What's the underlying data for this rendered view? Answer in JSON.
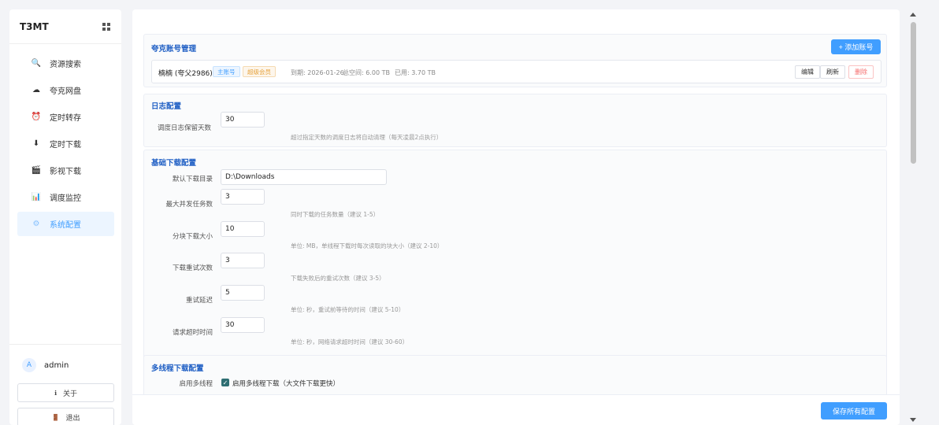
{
  "sidebar": {
    "brand": "T3MT",
    "items": [
      {
        "label": "资源搜索",
        "icon": "🔍"
      },
      {
        "label": "夸克网盘",
        "icon": "☁"
      },
      {
        "label": "定时转存",
        "icon": "⏰"
      },
      {
        "label": "定时下载",
        "icon": "⬇"
      },
      {
        "label": "影视下载",
        "icon": "🎬"
      },
      {
        "label": "调度监控",
        "icon": "📊"
      },
      {
        "label": "系统配置",
        "icon": "⚙"
      }
    ],
    "active_index": 6,
    "user": {
      "avatar": "A",
      "name": "admin"
    },
    "about_label": "关于",
    "about_icon": "ℹ",
    "logout_label": "退出",
    "logout_icon": "🚪"
  },
  "quark": {
    "title": "夸克账号管理",
    "add_button": "+ 添加账号",
    "account": {
      "name": "楠楠 (夸父2986)",
      "tag_main": "主账号",
      "tag_vip": "超级会员",
      "expire": "到期: 2026-01-26",
      "total": "总空间: 6.00 TB",
      "used": "已用: 3.70 TB",
      "edit": "编辑",
      "refresh": "刷新",
      "delete": "删除"
    }
  },
  "log": {
    "title": "日志配置",
    "retention_label": "调度日志保留天数",
    "retention_value": "30",
    "retention_hint": "超过指定天数的调度日志将自动清理（每天凌晨2点执行）"
  },
  "download": {
    "title": "基础下载配置",
    "dir_label": "默认下载目录",
    "dir_value": "D:\\Downloads",
    "concurrent_label": "最大并发任务数",
    "concurrent_value": "3",
    "concurrent_hint": "同时下载的任务数量（建议 1-5）",
    "chunk_label": "分块下载大小",
    "chunk_value": "10",
    "chunk_hint": "单位: MB，单线程下载时每次读取的块大小（建议 2-10）",
    "retry_label": "下载重试次数",
    "retry_value": "3",
    "retry_hint": "下载失败后的重试次数（建议 3-5）",
    "delay_label": "重试延迟",
    "delay_value": "5",
    "delay_hint": "单位: 秒，重试前等待的时间（建议 5-10）",
    "timeout_label": "请求超时时间",
    "timeout_value": "30",
    "timeout_hint": "单位: 秒，网络请求超时时间（建议 30-60）"
  },
  "multi": {
    "title": "多线程下载配置",
    "enable_label": "启用多线程",
    "enable_text": "启用多线程下载（大文件下载更快）",
    "enabled": true
  },
  "footer": {
    "save_button": "保存所有配置"
  },
  "colors": {
    "primary": "#409eff",
    "section_title": "#1f5fc4",
    "danger": "#f56c6c",
    "warning": "#e6a23c"
  }
}
